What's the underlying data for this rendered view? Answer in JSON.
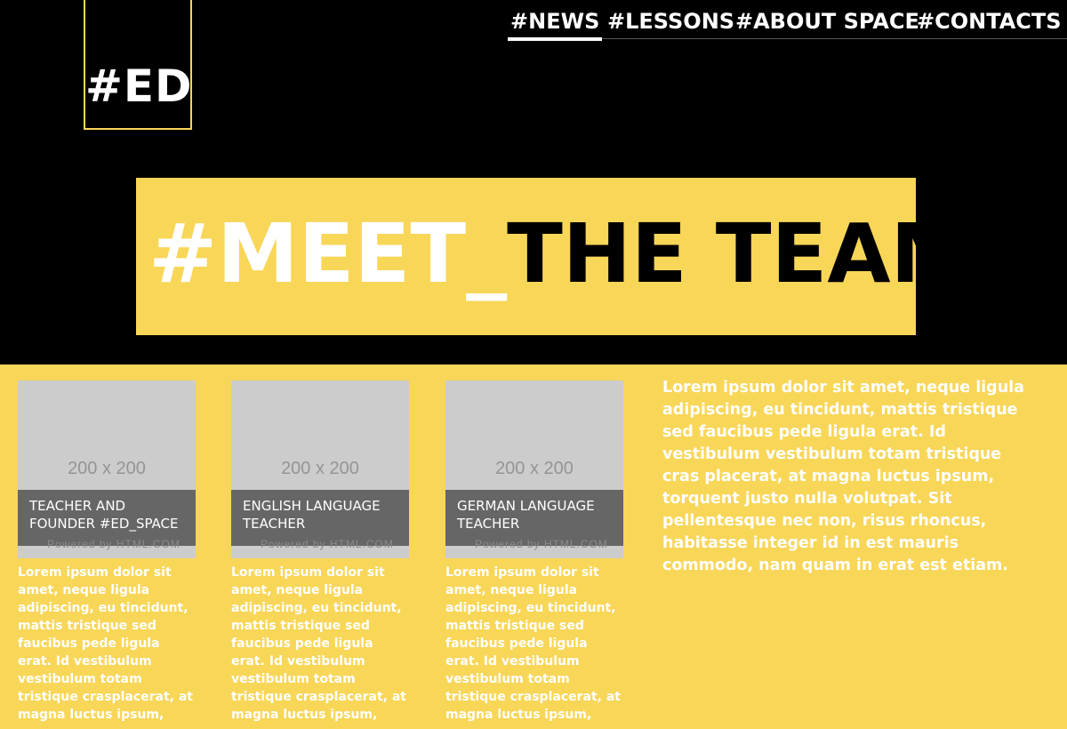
{
  "logo": {
    "text": "#ED"
  },
  "nav": {
    "items": [
      "#NEWS",
      "#LESSONS",
      "#ABOUT SPACE",
      "#CONTACTS"
    ],
    "active": "#NEWS"
  },
  "hero": {
    "title_part1": "#MEET_",
    "title_part2": "THE TEAM"
  },
  "team": [
    {
      "photo_placeholder": "200 x 200",
      "role": "TEACHER AND FOUNDER #ED_SPACE",
      "powered": "Powered by HTML.COM",
      "bio": "Lorem ipsum dolor sit amet, neque ligula adipiscing, eu tincidunt, mattis tristique sed faucibus pede ligula erat. Id vestibulum vestibulum totam tristique crasplacerat, at magna luctus ipsum,"
    },
    {
      "photo_placeholder": "200 x 200",
      "role": "ENGLISH LANGUAGE TEACHER",
      "powered": "Powered by HTML.COM",
      "bio": "Lorem ipsum dolor sit amet, neque ligula adipiscing, eu tincidunt, mattis tristique sed faucibus pede ligula erat. Id vestibulum vestibulum totam tristique crasplacerat, at magna luctus ipsum,"
    },
    {
      "photo_placeholder": "200 x 200",
      "role": "GERMAN LANGUAGE TEACHER",
      "powered": "Powered by HTML.COM",
      "bio": "Lorem ipsum dolor sit amet, neque ligula adipiscing, eu tincidunt, mattis tristique sed faucibus pede ligula erat. Id vestibulum vestibulum totam tristique crasplacerat, at magna luctus ipsum,"
    }
  ],
  "side_text": "Lorem ipsum dolor sit amet, neque ligula adipiscing, eu tincidunt, mattis tristique sed faucibus pede ligula erat. Id vestibulum vestibulum totam tristique cras placerat, at magna luctus ipsum, torquent justo nulla volutpat. Sit pellentesque nec non, risus rhoncus, habitasse integer id in est mauris commodo, nam quam in erat est etiam.",
  "colors": {
    "accent": "#f8d658",
    "background": "#000000",
    "photo_placeholder": "#cccccc",
    "caption_bar": "#666666"
  }
}
